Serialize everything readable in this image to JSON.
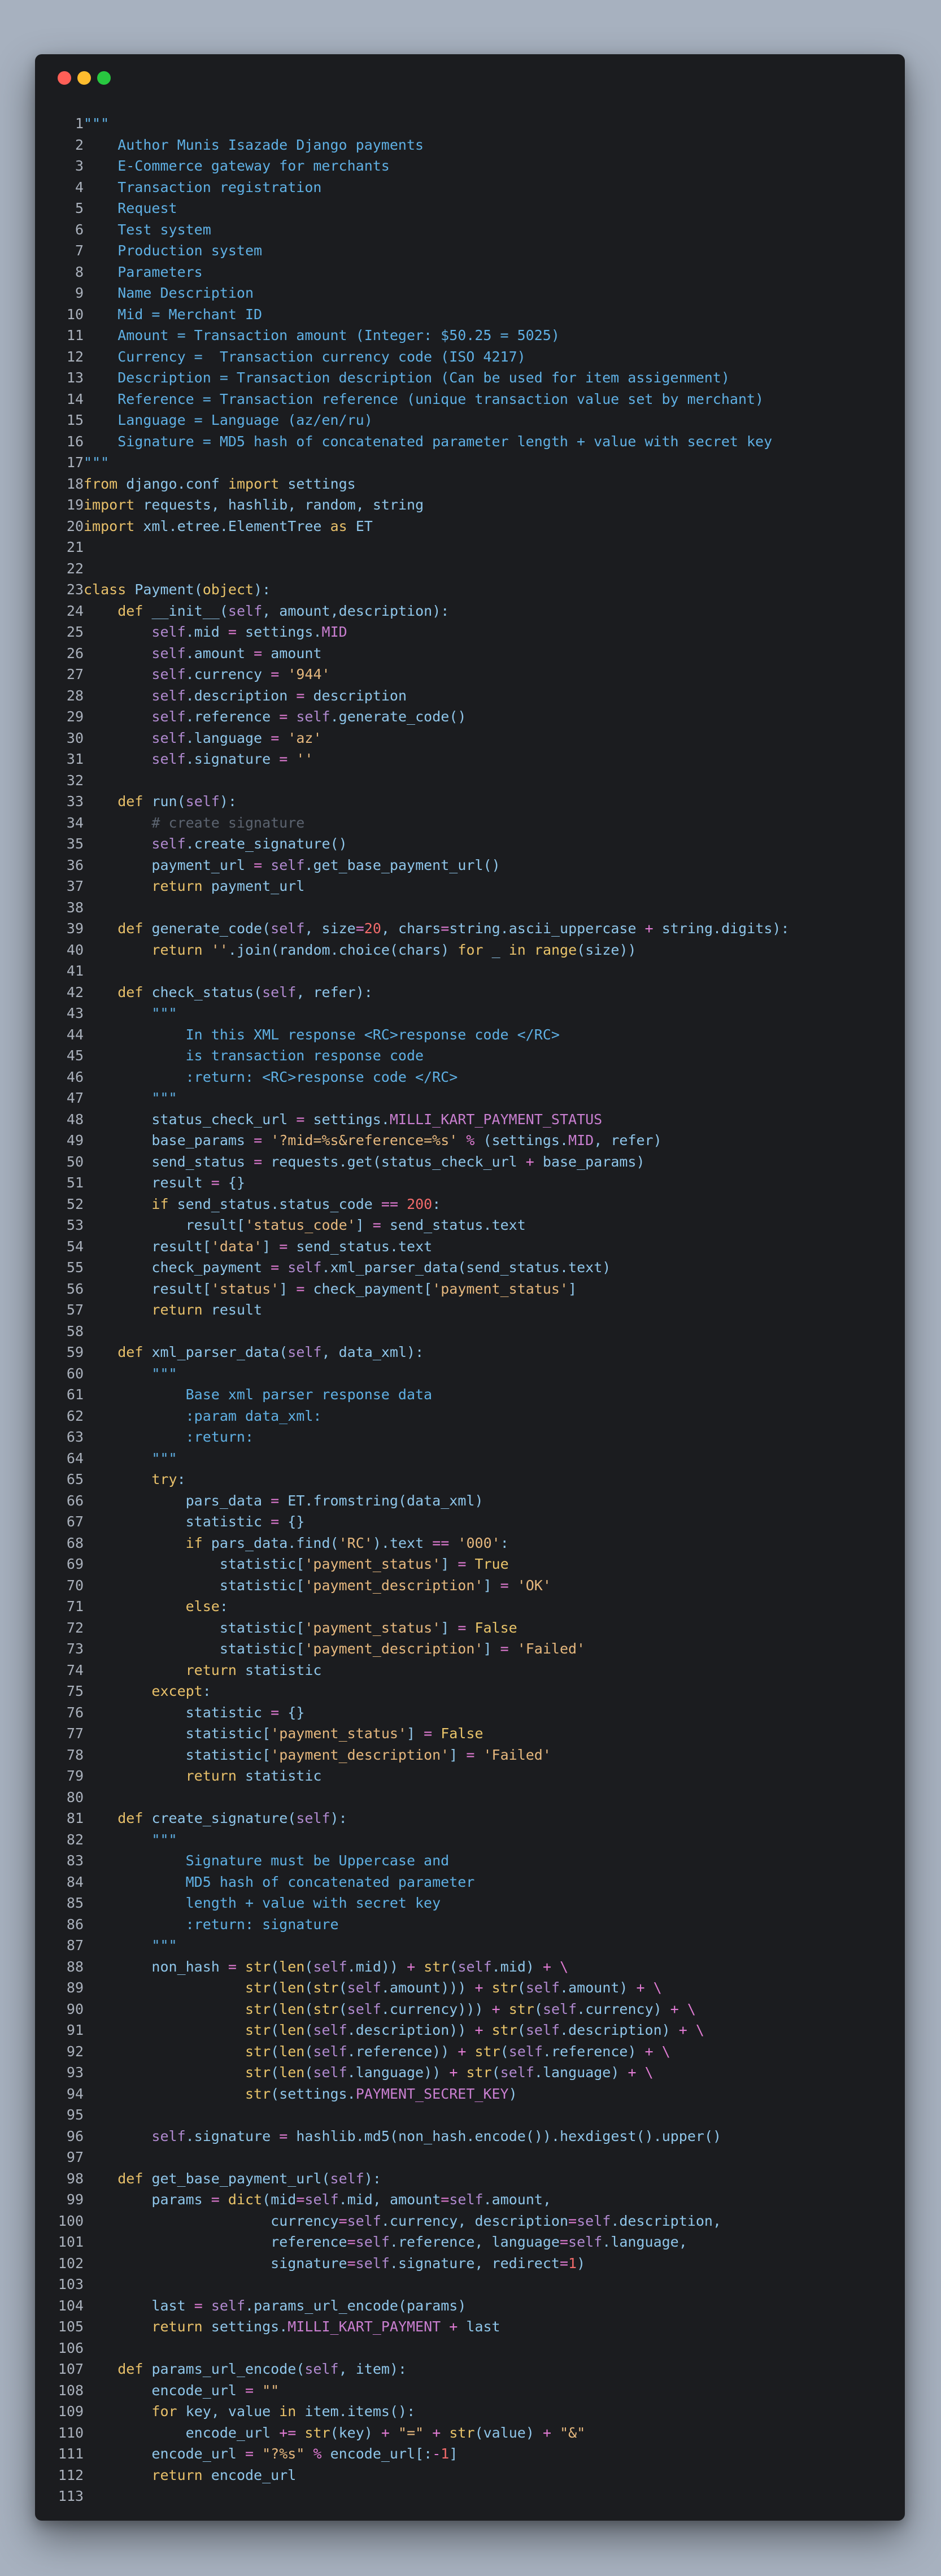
{
  "window": {
    "controls": [
      "close",
      "minimize",
      "maximize"
    ],
    "colors": {
      "close": "#ff5f57",
      "minimize": "#febc2e",
      "maximize": "#28c840",
      "background": "#1b1c1f"
    }
  },
  "code": {
    "language": "python",
    "lines": [
      "\"\"\"",
      "    Author Munis Isazade Django payments",
      "    E-Commerce gateway for merchants",
      "    Transaction registration",
      "    Request",
      "    Test system",
      "    Production system",
      "    Parameters",
      "    Name Description",
      "    Mid = Merchant ID",
      "    Amount = Transaction amount (Integer: $50.25 = 5025)",
      "    Currency =  Transaction currency code (ISO 4217)",
      "    Description = Transaction description (Can be used for item assigenment)",
      "    Reference = Transaction reference (unique transaction value set by merchant)",
      "    Language = Language (az/en/ru)",
      "    Signature = MD5 hash of concatenated parameter length + value with secret key",
      "\"\"\"",
      "from django.conf import settings",
      "import requests, hashlib, random, string",
      "import xml.etree.ElementTree as ET",
      "",
      "",
      "class Payment(object):",
      "    def __init__(self, amount,description):",
      "        self.mid = settings.MID",
      "        self.amount = amount",
      "        self.currency = '944'",
      "        self.description = description",
      "        self.reference = self.generate_code()",
      "        self.language = 'az'",
      "        self.signature = ''",
      "",
      "    def run(self):",
      "        # create signature",
      "        self.create_signature()",
      "        payment_url = self.get_base_payment_url()",
      "        return payment_url",
      "",
      "    def generate_code(self, size=20, chars=string.ascii_uppercase + string.digits):",
      "        return ''.join(random.choice(chars) for _ in range(size))",
      "",
      "    def check_status(self, refer):",
      "        \"\"\"",
      "            In this XML response <RC>response code </RC>",
      "            is transaction response code",
      "            :return: <RC>response code </RC>",
      "        \"\"\"",
      "        status_check_url = settings.MILLI_KART_PAYMENT_STATUS",
      "        base_params = '?mid=%s&reference=%s' % (settings.MID, refer)",
      "        send_status = requests.get(status_check_url + base_params)",
      "        result = {}",
      "        if send_status.status_code == 200:",
      "            result['status_code'] = send_status.text",
      "        result['data'] = send_status.text",
      "        check_payment = self.xml_parser_data(send_status.text)",
      "        result['status'] = check_payment['payment_status']",
      "        return result",
      "",
      "    def xml_parser_data(self, data_xml):",
      "        \"\"\"",
      "            Base xml parser response data",
      "            :param data_xml:",
      "            :return:",
      "        \"\"\"",
      "        try:",
      "            pars_data = ET.fromstring(data_xml)",
      "            statistic = {}",
      "            if pars_data.find('RC').text == '000':",
      "                statistic['payment_status'] = True",
      "                statistic['payment_description'] = 'OK'",
      "            else:",
      "                statistic['payment_status'] = False",
      "                statistic['payment_description'] = 'Failed'",
      "            return statistic",
      "        except:",
      "            statistic = {}",
      "            statistic['payment_status'] = False",
      "            statistic['payment_description'] = 'Failed'",
      "            return statistic",
      "",
      "    def create_signature(self):",
      "        \"\"\"",
      "            Signature must be Uppercase and",
      "            MD5 hash of concatenated parameter",
      "            length + value with secret key",
      "            :return: signature",
      "        \"\"\"",
      "        non_hash = str(len(self.mid)) + str(self.mid) + \\",
      "                   str(len(str(self.amount))) + str(self.amount) + \\",
      "                   str(len(str(self.currency))) + str(self.currency) + \\",
      "                   str(len(self.description)) + str(self.description) + \\",
      "                   str(len(self.reference)) + str(self.reference) + \\",
      "                   str(len(self.language)) + str(self.language) + \\",
      "                   str(settings.PAYMENT_SECRET_KEY)",
      "",
      "        self.signature = hashlib.md5(non_hash.encode()).hexdigest().upper()",
      "",
      "    def get_base_payment_url(self):",
      "        params = dict(mid=self.mid, amount=self.amount,",
      "                      currency=self.currency, description=self.description,",
      "                      reference=self.reference, language=self.language,",
      "                      signature=self.signature, redirect=1)",
      "",
      "        last = self.params_url_encode(params)",
      "        return settings.MILLI_KART_PAYMENT + last",
      "",
      "    def params_url_encode(self, item):",
      "        encode_url = \"\"",
      "        for key, value in item.items():",
      "            encode_url += str(key) + \"=\" + str(value) + \"&\"",
      "        encode_url = \"?%s\" % encode_url[:-1]",
      "        return encode_url",
      ""
    ]
  }
}
